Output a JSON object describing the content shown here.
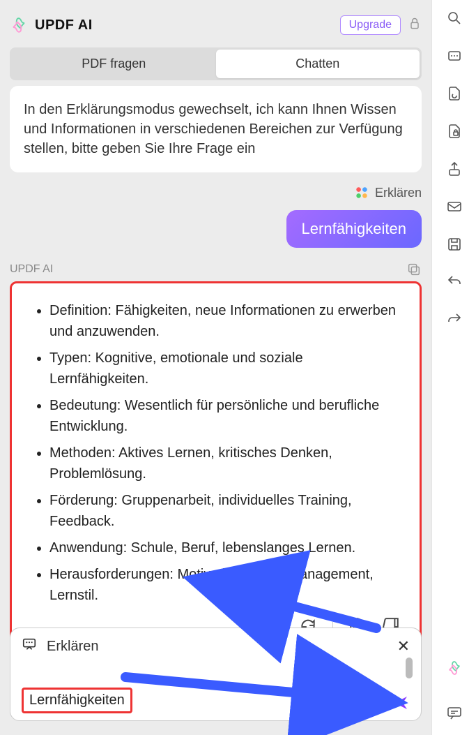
{
  "header": {
    "title": "UPDF AI",
    "upgrade_label": "Upgrade"
  },
  "tabs": {
    "pdf": "PDF fragen",
    "chat": "Chatten"
  },
  "mode_label": "Erklären",
  "system_message": "In den Erklärungsmodus gewechselt, ich kann Ihnen Wissen und Informationen in verschiedenen Bereichen zur Verfügung stellen, bitte geben Sie Ihre Frage ein",
  "user_message": "Lernfähigkeiten",
  "ai_label": "UPDF AI",
  "answer": {
    "points": [
      "Definition: Fähigkeiten, neue Informationen zu erwerben und anzuwenden.",
      "Typen: Kognitive, emotionale und soziale Lernfähigkeiten.",
      "Bedeutung: Wesentlich für persönliche und berufliche Entwicklung.",
      "Methoden: Aktives Lernen, kritisches Denken, Problemlösung.",
      "Förderung: Gruppenarbeit, individuelles Training, Feedback.",
      "Anwendung: Schule, Beruf, lebenslanges Lernen.",
      "Herausforderungen: Motivation, Stressmanagement, Lernstil."
    ]
  },
  "input": {
    "mode_label": "Erklären",
    "value": "Lernfähigkeiten"
  },
  "sidebar_icons": [
    "search-icon",
    "ocr-icon",
    "page-sync-icon",
    "page-lock-icon",
    "share-icon",
    "mail-icon",
    "save-icon",
    "undo-icon",
    "redo-icon"
  ]
}
